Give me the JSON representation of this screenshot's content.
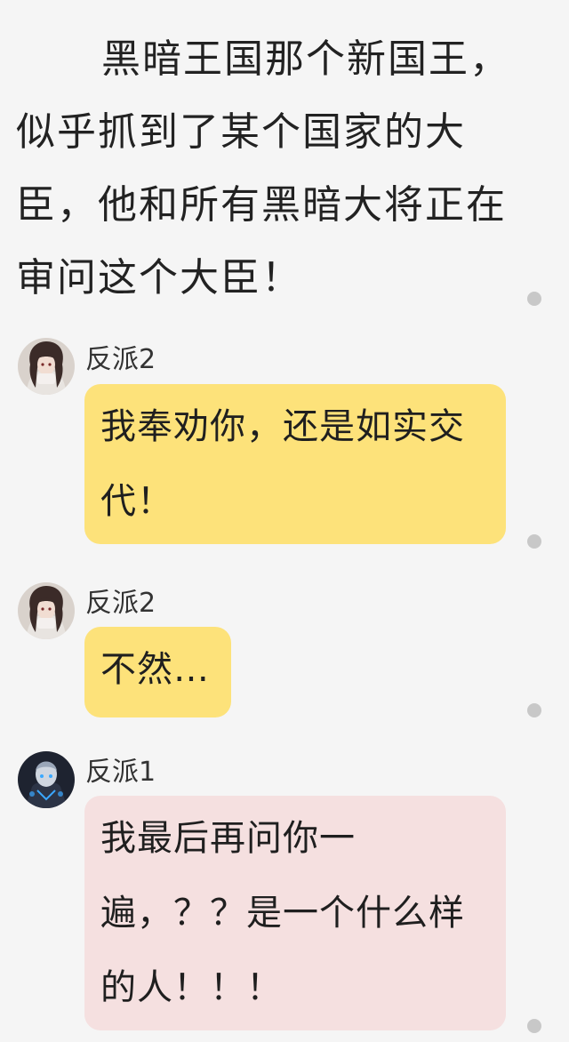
{
  "narration": {
    "text": "黑暗王国那个新国王，似乎抓到了某个国家的大臣，他和所有黑暗大将正在审问这个大臣！"
  },
  "messages": [
    {
      "sender": "反派2",
      "text": "我奉劝你，还是如实交代！",
      "bubble_color": "#fde27a"
    },
    {
      "sender": "反派2",
      "text": "不然…",
      "bubble_color": "#fde27a"
    },
    {
      "sender": "反派1",
      "text": "我最后再问你一遍，？？是一个什么样的人！！！",
      "bubble_color": "#f5e0e0"
    }
  ],
  "colors": {
    "background": "#f5f5f5",
    "dot": "#c8c8c8"
  }
}
